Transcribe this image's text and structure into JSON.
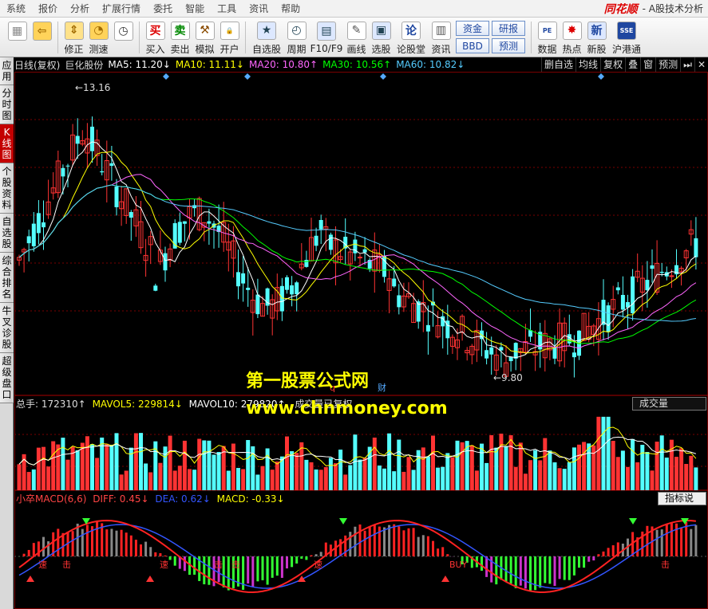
{
  "menu": [
    "系统",
    "报价",
    "分析",
    "扩展行情",
    "委托",
    "智能",
    "工具",
    "资讯",
    "帮助"
  ],
  "brand": {
    "logo": "同花顺",
    "title": "- A股技术分析"
  },
  "toolbar": {
    "buttons": [
      {
        "label": "",
        "icon": "grid-icon"
      },
      {
        "label": "",
        "icon": "back-arrow-icon"
      },
      {
        "label": "修正",
        "icon": "updown-arrow-icon"
      },
      {
        "label": "测速",
        "icon": "speed-icon"
      },
      {
        "label": "",
        "icon": "clock-icon"
      },
      {
        "label": "买入",
        "icon": "buy-icon"
      },
      {
        "label": "卖出",
        "icon": "sell-icon"
      },
      {
        "label": "模拟",
        "icon": "hammer-icon"
      },
      {
        "label": "开户",
        "icon": "lock-icon"
      },
      {
        "label": "自选股",
        "icon": "star-icon"
      },
      {
        "label": "周期",
        "icon": "cycle-icon"
      },
      {
        "label": "F10/F9",
        "icon": "f10-icon"
      },
      {
        "label": "画线",
        "icon": "pen-icon"
      },
      {
        "label": "选股",
        "icon": "select-stock-icon"
      },
      {
        "label": "论股堂",
        "icon": "forum-icon"
      },
      {
        "label": "资讯",
        "icon": "news-icon"
      },
      {
        "label": "数据",
        "icon": "pe-icon"
      },
      {
        "label": "热点",
        "icon": "hot-icon"
      },
      {
        "label": "新股",
        "icon": "new-stock-icon"
      },
      {
        "label": "沪港通",
        "icon": "hkex-icon"
      }
    ],
    "boxes": [
      "资金",
      "BBD",
      "研报",
      "预测"
    ]
  },
  "sidetabs": [
    "应用",
    "分时图",
    "K线图",
    "个股资料",
    "自选股",
    "综合排名",
    "牛叉诊股",
    "超级盘口"
  ],
  "active_sidetab": "K线图",
  "info": {
    "period": "日线(复权)",
    "name": "巨化股份",
    "ma": [
      {
        "label": "MA5: 11.20↓",
        "color": "#ffffff"
      },
      {
        "label": "MA10: 11.11↓",
        "color": "#ffff00"
      },
      {
        "label": "MA20: 10.80↑",
        "color": "#ff66ff"
      },
      {
        "label": "MA30: 10.56↑",
        "color": "#00ff00"
      },
      {
        "label": "MA60: 10.82↓",
        "color": "#55ccff"
      }
    ],
    "right_buttons": [
      "删自选",
      "均线",
      "复权",
      "叠",
      "窗",
      "预测",
      "⏭",
      "✕"
    ]
  },
  "price_panel": {
    "high_label": "13.16",
    "low_label": "9.80",
    "markers": [
      "q",
      "财"
    ]
  },
  "volume_panel": {
    "total": "总手: 172310↑",
    "mavol5": "MAVOL5: 229814↓",
    "mavol10": "MAVOL10: 279820↑",
    "note": "成交量已复权",
    "selector": "成交量"
  },
  "macd_panel": {
    "name": "小卒MACD(6,6)",
    "diff": "DIFF: 0.45↓",
    "dea": "DEA: 0.62↓",
    "macd": "MACD: -0.33↓",
    "button": "指标说明",
    "labels": [
      "速",
      "击",
      "速",
      "击",
      "击",
      "速",
      "BUY",
      "击"
    ]
  },
  "watermark": {
    "line1": "第一股票公式网",
    "line2": "www.chnmoney.com"
  },
  "colors": {
    "up": "#ff3333",
    "down": "#54ffff",
    "grid": "#7a0000",
    "bg": "#000000"
  }
}
